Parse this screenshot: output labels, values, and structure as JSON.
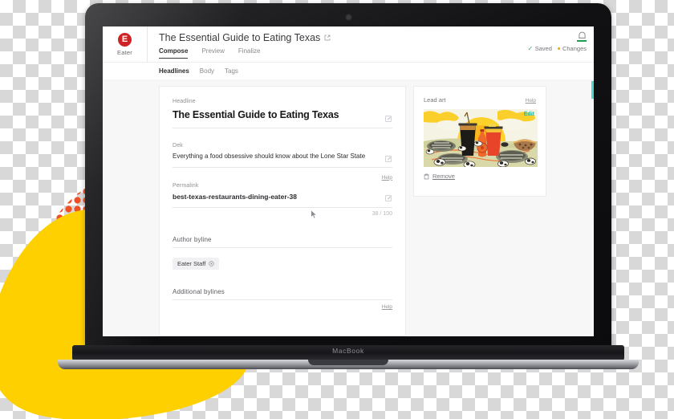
{
  "device": {
    "name": "MacBook"
  },
  "brand": {
    "mark_letter": "E",
    "name": "Eater",
    "color": "#cf2224"
  },
  "header": {
    "doc_title": "The Essential Guide to Eating Texas",
    "external_link_icon": "external-link-icon",
    "view_tabs": [
      {
        "label": "Compose",
        "active": true
      },
      {
        "label": "Preview",
        "active": false
      },
      {
        "label": "Finalize",
        "active": false
      }
    ],
    "notification_icon": "bell-icon",
    "status": {
      "saved_label": "Saved",
      "saved_check": "✓",
      "saved_color": "#3fa95f",
      "changes_label": "Changes",
      "changes_color": "#f0a21c"
    }
  },
  "subtabs": [
    {
      "label": "Headlines",
      "active": true
    },
    {
      "label": "Body",
      "active": false
    },
    {
      "label": "Tags",
      "active": false
    }
  ],
  "form": {
    "headline": {
      "label": "Headline",
      "value": "The Essential Guide to Eating Texas",
      "edit_icon": "edit-icon"
    },
    "dek": {
      "label": "Dek",
      "value": "Everything a food obsessive should know about the Lone Star State",
      "edit_icon": "edit-icon"
    },
    "permalink": {
      "help_label": "Help",
      "label": "Permalink",
      "value": "best-texas-restaurants-dining-eater-38",
      "counter": "38 / 100",
      "edit_icon": "edit-icon"
    },
    "author_byline": {
      "label": "Author byline",
      "chip": "Eater Staff",
      "chip_remove_icon": "close-circle-icon"
    },
    "additional_bylines": {
      "label": "Additional bylines",
      "help_label": "Help"
    }
  },
  "aside": {
    "title": "Lead art",
    "help_label": "Help",
    "edit_label": "Edit",
    "edit_color": "#2fb5a8",
    "remove_label": "Remove",
    "trash_icon": "trash-icon",
    "artwork_alt": "Illustration of Texas food and drink: iced coffee, red drink, bottle, brisket platters and cattle at sunset"
  },
  "decor": {
    "blob_color": "#ffd000",
    "dots_color": "#f04e23"
  }
}
